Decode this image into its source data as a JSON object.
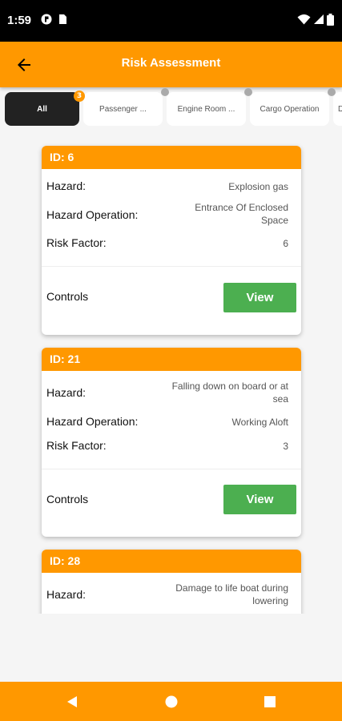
{
  "status": {
    "time": "1:59"
  },
  "appbar": {
    "title": "Risk Assessment"
  },
  "filters": [
    {
      "label": "All",
      "badge": "3"
    },
    {
      "label": "Passenger ..."
    },
    {
      "label": "Engine Room ..."
    },
    {
      "label": "Cargo Operation"
    },
    {
      "label": "D"
    }
  ],
  "labels": {
    "hazard": "Hazard:",
    "operation": "Hazard Operation:",
    "risk": "Risk Factor:",
    "controls": "Controls",
    "view": "View"
  },
  "cards": [
    {
      "id": "ID: 6",
      "hazard": "Explosion gas",
      "operation": "Entrance Of Enclosed Space",
      "risk": "6"
    },
    {
      "id": "ID: 21",
      "hazard": "Falling down on board or at sea",
      "operation": "Working Aloft",
      "risk": "3"
    },
    {
      "id": "ID: 28",
      "hazard": "Damage to life boat during lowering"
    }
  ],
  "colors": {
    "accent": "#ff9800",
    "view": "#4caf50",
    "chip_active": "#222222"
  }
}
